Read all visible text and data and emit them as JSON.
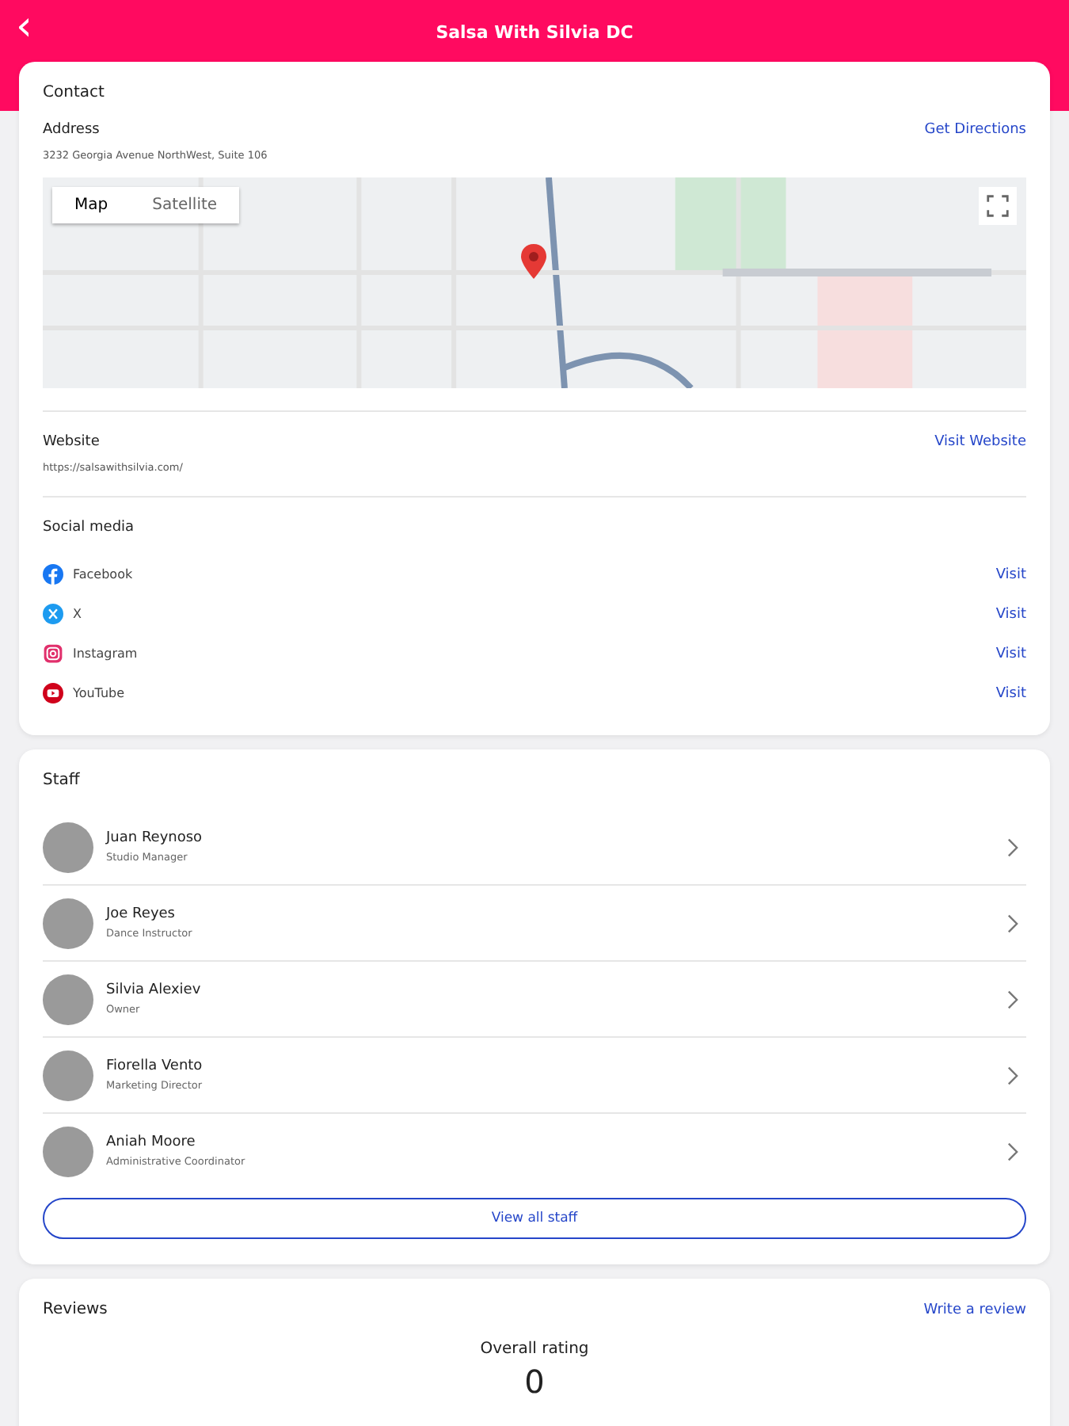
{
  "header": {
    "back": "‹",
    "title": "Salsa With Silvia DC"
  },
  "contact": {
    "title": "Contact",
    "address": {
      "label": "Address",
      "value": "3232 Georgia Avenue NorthWest, Suite 106",
      "action": "Get Directions"
    },
    "map": {
      "types": [
        {
          "label": "Map",
          "selected": true
        },
        {
          "label": "Satellite",
          "selected": false
        }
      ]
    },
    "website": {
      "label": "Website",
      "value": "https://salsawithsilvia.com/",
      "action": "Visit Website"
    },
    "social": {
      "label": "Social media",
      "items": [
        {
          "kind": "facebook",
          "name": "Facebook",
          "action": "Visit"
        },
        {
          "kind": "x",
          "name": "X",
          "action": "Visit"
        },
        {
          "kind": "instagram",
          "name": "Instagram",
          "action": "Visit"
        },
        {
          "kind": "youtube",
          "name": "YouTube",
          "action": "Visit"
        }
      ]
    }
  },
  "staff": {
    "title": "Staff",
    "members": [
      {
        "name": "Juan Reynoso",
        "role": "Studio Manager"
      },
      {
        "name": "Joe Reyes",
        "role": "Dance Instructor"
      },
      {
        "name": "Silvia Alexiev",
        "role": "Owner"
      },
      {
        "name": "Fiorella Vento",
        "role": "Marketing Director"
      },
      {
        "name": "Aniah Moore",
        "role": "Administrative Coordinator"
      }
    ],
    "button": "View all staff"
  },
  "reviews": {
    "title": "Reviews",
    "action": "Write a review",
    "overall_label": "Overall rating",
    "overall_value": "0"
  }
}
